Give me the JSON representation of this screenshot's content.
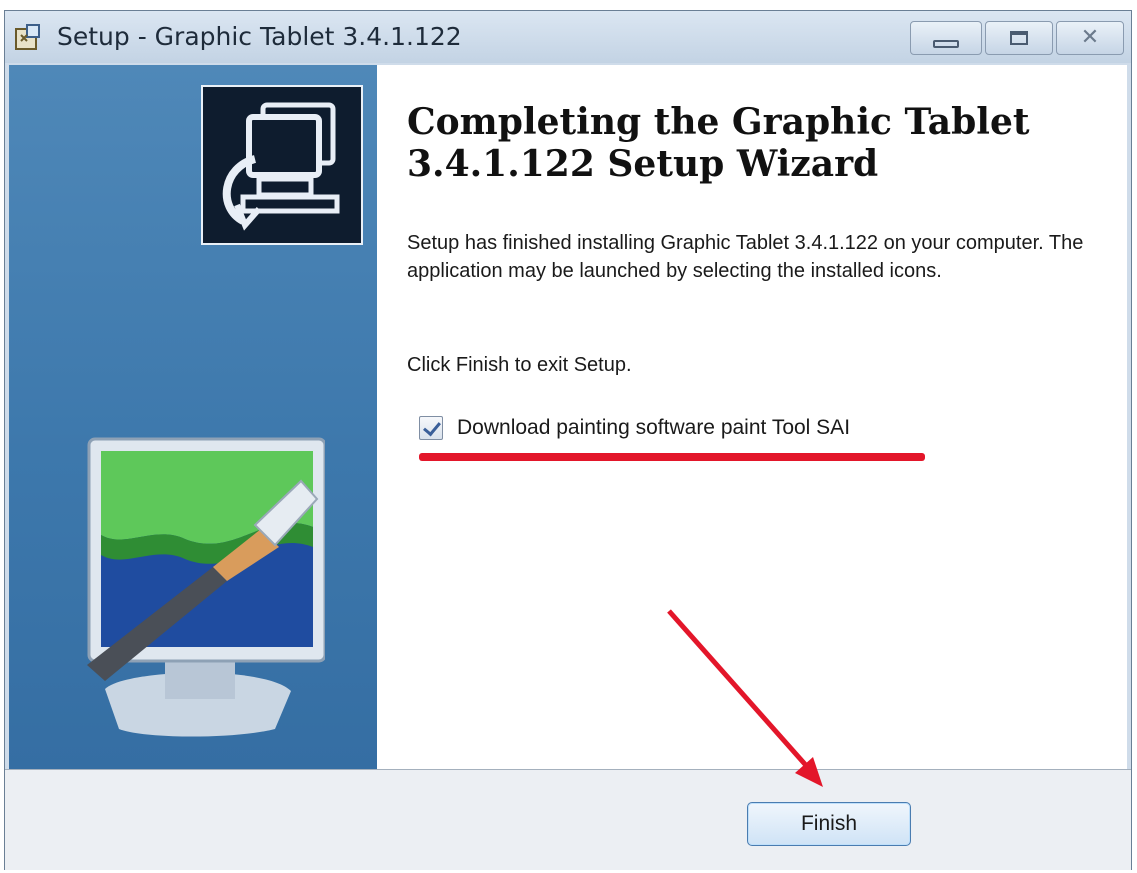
{
  "window": {
    "title": "Setup - Graphic Tablet 3.4.1.122",
    "icon": "setup-icon",
    "controls": [
      "minimize-icon",
      "maximize-icon",
      "close-icon"
    ]
  },
  "main": {
    "heading": "Completing the Graphic Tablet 3.4.1.122 Setup Wizard",
    "paragraph1": "Setup has finished installing Graphic Tablet 3.4.1.122 on your computer. The application may be launched by selecting the installed icons.",
    "paragraph2": "Click Finish to exit Setup.",
    "checkbox": {
      "label": "Download painting software paint Tool SAI",
      "checked": true
    }
  },
  "footer": {
    "finish_label": "Finish"
  },
  "colors": {
    "sidebar": "#3d78ac",
    "annotation": "#e3162a"
  }
}
